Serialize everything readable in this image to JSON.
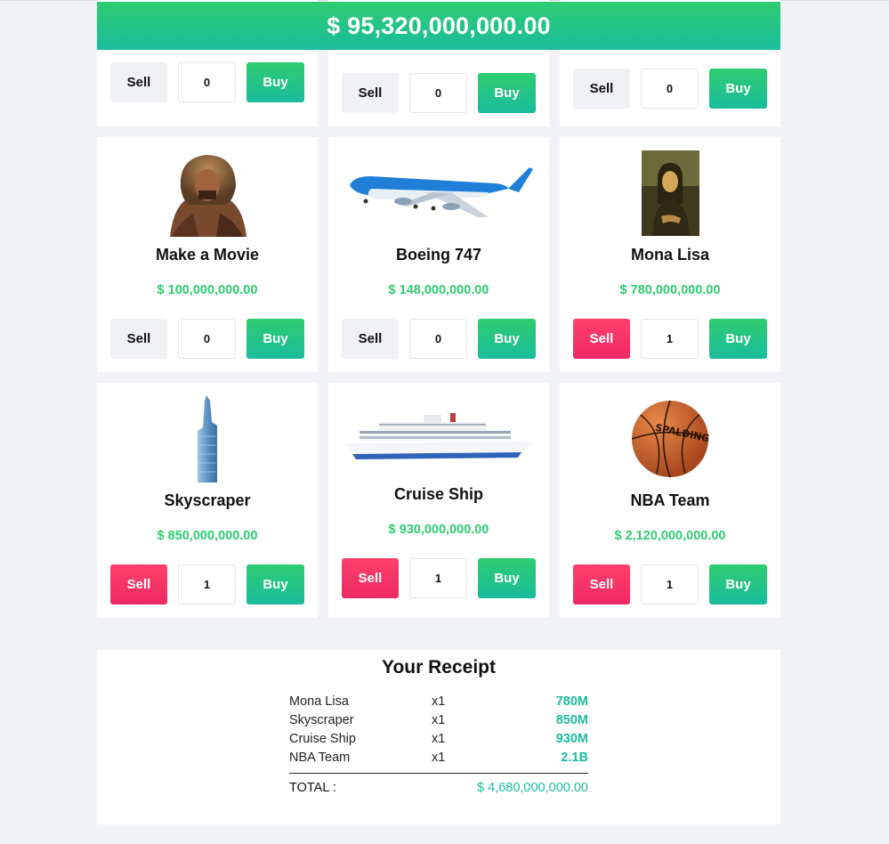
{
  "money": "$ 95,320,000,000.00",
  "colors": {
    "green": "#2ecc71",
    "teal": "#1abc9c",
    "pink": "#ff3f6c",
    "sell_idle": "#f0f1f4"
  },
  "top_row": [
    {
      "sell_label": "Sell",
      "qty": "0",
      "buy_label": "Buy"
    },
    {
      "sell_label": "Sell",
      "qty": "0",
      "buy_label": "Buy"
    },
    {
      "sell_label": "Sell",
      "qty": "0",
      "buy_label": "Buy"
    }
  ],
  "products": [
    {
      "name": "Make a Movie",
      "price": "$ 100,000,000.00",
      "qty": "0",
      "sell_label": "Sell",
      "buy_label": "Buy",
      "icon": "movie-actor-image",
      "sell_active": false
    },
    {
      "name": "Boeing 747",
      "price": "$ 148,000,000.00",
      "qty": "0",
      "sell_label": "Sell",
      "buy_label": "Buy",
      "icon": "airplane-image",
      "sell_active": false
    },
    {
      "name": "Mona Lisa",
      "price": "$ 780,000,000.00",
      "qty": "1",
      "sell_label": "Sell",
      "buy_label": "Buy",
      "icon": "painting-image",
      "sell_active": true
    },
    {
      "name": "Skyscraper",
      "price": "$ 850,000,000.00",
      "qty": "1",
      "sell_label": "Sell",
      "buy_label": "Buy",
      "icon": "skyscraper-image",
      "sell_active": true
    },
    {
      "name": "Cruise Ship",
      "price": "$ 930,000,000.00",
      "qty": "1",
      "sell_label": "Sell",
      "buy_label": "Buy",
      "icon": "cruise-ship-image",
      "sell_active": true
    },
    {
      "name": "NBA Team",
      "price": "$ 2,120,000,000.00",
      "qty": "1",
      "sell_label": "Sell",
      "buy_label": "Buy",
      "icon": "basketball-image",
      "sell_active": true
    }
  ],
  "receipt": {
    "title": "Your Receipt",
    "items": [
      {
        "name": "Mona Lisa",
        "qty": "x1",
        "amount": "780M"
      },
      {
        "name": "Skyscraper",
        "qty": "x1",
        "amount": "850M"
      },
      {
        "name": "Cruise Ship",
        "qty": "x1",
        "amount": "930M"
      },
      {
        "name": "NBA Team",
        "qty": "x1",
        "amount": "2.1B"
      }
    ],
    "total_label": "TOTAL :",
    "total_value": "$ 4,680,000,000.00"
  }
}
